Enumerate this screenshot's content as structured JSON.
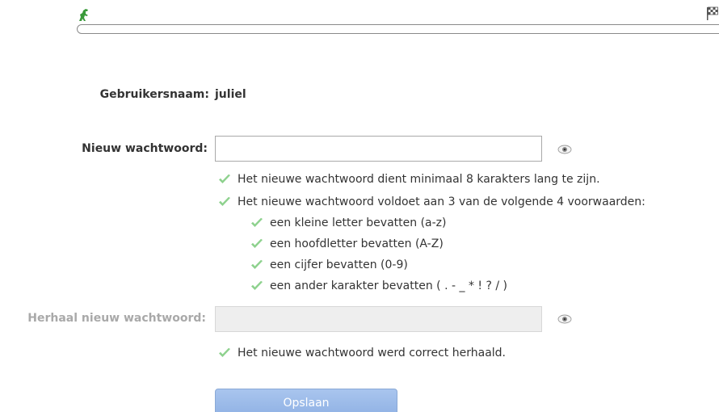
{
  "progress": {
    "start_icon": "dinosaur-icon",
    "end_icon": "checkered-flag-icon",
    "value": 0
  },
  "username": {
    "label": "Gebruikersnaam:",
    "value": "juliel"
  },
  "new_password": {
    "label": "Nieuw wachtwoord:",
    "value": "",
    "toggle_icon": "eye-icon"
  },
  "rules": {
    "min_length": "Het nieuwe wachtwoord dient minimaal 8 karakters lang te zijn.",
    "conditions_intro": "Het nieuwe wachtwoord voldoet aan 3 van de volgende 4 voorwaarden:",
    "lowercase": "een kleine letter bevatten (a-z)",
    "uppercase": "een hoofdletter bevatten (A-Z)",
    "digit": "een cijfer bevatten (0-9)",
    "special": "een ander karakter bevatten ( . - _ * ! ? / )"
  },
  "repeat_password": {
    "label": "Herhaal nieuw wachtwoord:",
    "value": "",
    "toggle_icon": "eye-icon",
    "match_message": "Het nieuwe wachtwoord werd correct herhaald."
  },
  "save_button": {
    "label": "Opslaan"
  },
  "colors": {
    "check": "#8dd18d",
    "button": "#9dbbea",
    "dino": "#3a9a3a"
  }
}
